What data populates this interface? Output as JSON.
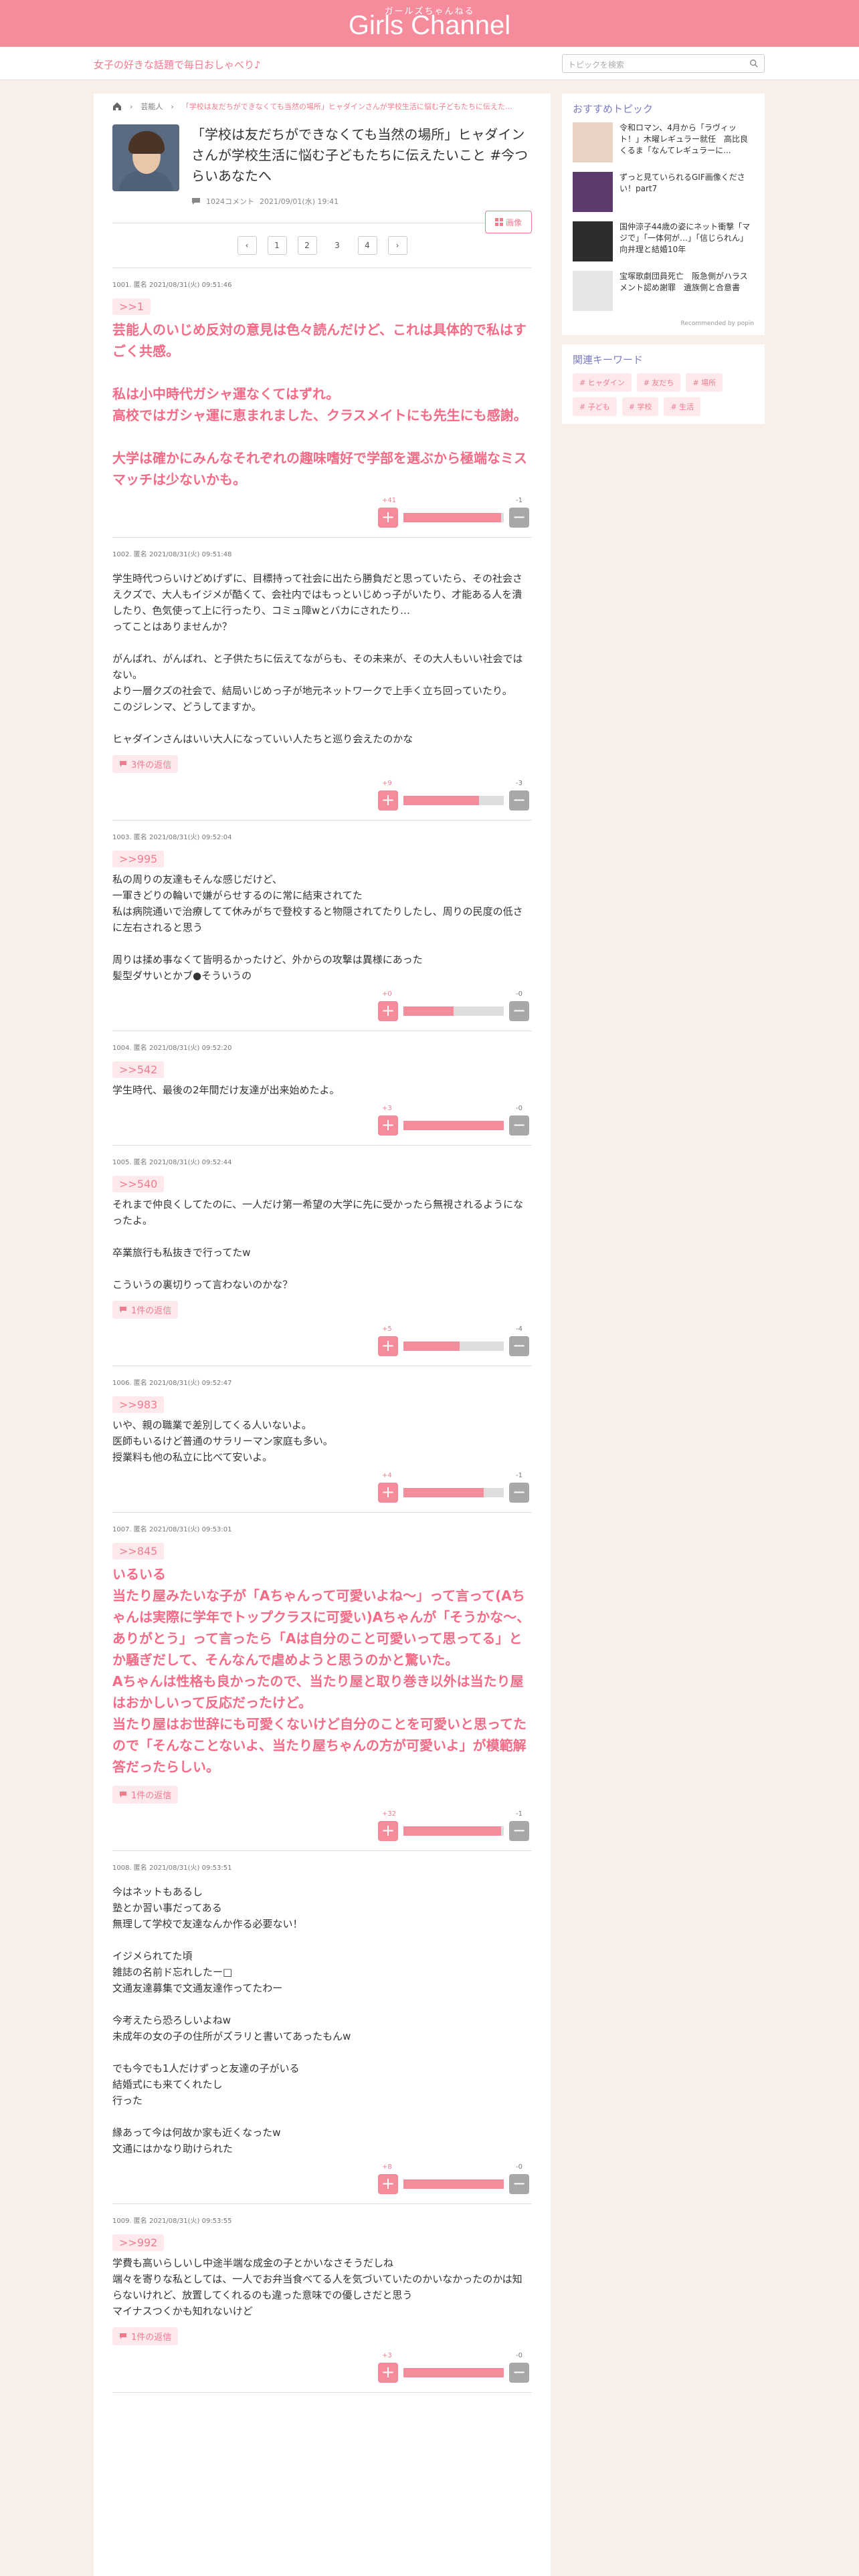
{
  "header": {
    "logo_sub": "ガールズちゃんねる",
    "logo": "Girls Channel",
    "tagline": "女子の好きな話題で毎日おしゃべり♪",
    "search_placeholder": "トピックを検索"
  },
  "breadcrumb": {
    "cat": "芸能人",
    "topic": "「学校は友だちができなくても当然の場所」ヒャダインさんが学校生活に悩む子どもたちに伝えたいこと #今つらいあなたへ"
  },
  "topic": {
    "title": "「学校は友だちができなくても当然の場所」ヒャダインさんが学校生活に悩む子どもたちに伝えたいこと #今つらいあなたへ",
    "comments": "1024コメント",
    "date": "2021/09/01(水) 19:41",
    "image_button": "画像"
  },
  "pager": {
    "prev": "‹",
    "pages": [
      "1",
      "2",
      "3",
      "4"
    ],
    "next": "›"
  },
  "comments": [
    {
      "head": "1001. 匿名 2021/08/31(火) 09:51:46",
      "anchor": ">>1",
      "text": "芸能人のいじめ反対の意見は色々読んだけど、これは具体的で私はすごく共感。\n\n私は小中時代ガシャ運なくてはずれ。\n高校ではガシャ運に恵まれました、クラスメイトにも先生にも感謝。\n\n大学は確かにみんなそれぞれの趣味嗜好で学部を選ぶから極端なミスマッチは少ないかも。",
      "plus": "+41",
      "minus": "-1",
      "ratio": 0.97
    },
    {
      "head": "1002. 匿名 2021/08/31(火) 09:51:48",
      "text": "学生時代つらいけどめげずに、目標持って社会に出たら勝負だと思っていたら、その社会さえクズで、大人もイジメが酷くて、会社内ではもっといじめっ子がいたり、才能ある人を潰したり、色気使って上に行ったり、コミュ障wとバカにされたり…\nってことはありませんか？\n\nがんばれ、がんばれ、と子供たちに伝えてながらも、その未来が、その大人もいい社会ではない。\nより一層クズの社会で、結局いじめっ子が地元ネットワークで上手く立ち回っていたり。\nこのジレンマ、どうしてますか。\n\nヒャダインさんはいい大人になっていい人たちと巡り会えたのかな",
      "reply": "3件の返信",
      "plus": "+9",
      "minus": "-3",
      "ratio": 0.75
    },
    {
      "head": "1003. 匿名 2021/08/31(火) 09:52:04",
      "anchor": ">>995",
      "text": "私の周りの友達もそんな感じだけど、\n一軍きどりの輪いで嫌がらせするのに常に結束されてた\n私は病院通いで治療してて休みがちで登校すると物隠されてたりしたし、周りの民度の低さに左右されると思う\n\n周りは揉め事なくて皆明るかったけど、外からの攻撃は異様にあった\n髪型ダサいとかブ●そういうの",
      "plus": "+0",
      "minus": "-0",
      "ratio": 0.5
    },
    {
      "head": "1004. 匿名 2021/08/31(火) 09:52:20",
      "anchor": ">>542",
      "text": "学生時代、最後の2年間だけ友達が出来始めたよ。",
      "plus": "+3",
      "minus": "-0",
      "ratio": 1
    },
    {
      "head": "1005. 匿名 2021/08/31(火) 09:52:44",
      "anchor": ">>540",
      "text": "それまで仲良くしてたのに、一人だけ第一希望の大学に先に受かったら無視されるようになったよ。\n\n卒業旅行も私抜きで行ってたw\n\nこういうの裏切りって言わないのかな？",
      "reply": "1件の返信",
      "plus": "+5",
      "minus": "-4",
      "ratio": 0.56
    },
    {
      "head": "1006. 匿名 2021/08/31(火) 09:52:47",
      "anchor": ">>983",
      "text": "いや、親の職業で差別してくる人いないよ。\n医師もいるけど普通のサラリーマン家庭も多い。\n授業料も他の私立に比べて安いよ。",
      "plus": "+4",
      "minus": "-1",
      "ratio": 0.8
    },
    {
      "head": "1007. 匿名 2021/08/31(火) 09:53:01",
      "anchor": ">>845",
      "text": "いるいる\n当たり屋みたいな子が「Aちゃんって可愛いよね〜」って言って(Aちゃんは実際に学年でトップクラスに可愛い)Aちゃんが「そうかな〜、ありがとう」って言ったら「Aは自分のこと可愛いって思ってる」とか騒ぎだして、そんなんで虐めようと思うのかと驚いた。\nAちゃんは性格も良かったので、当たり屋と取り巻き以外は当たり屋はおかしいって反応だったけど。\n当たり屋はお世辞にも可愛くないけど自分のことを可愛いと思ってたので「そんなことないよ、当たり屋ちゃんの方が可愛いよ」が模範解答だったらしい。",
      "reply": "1件の返信",
      "plus": "+32",
      "minus": "-1",
      "ratio": 0.97
    },
    {
      "head": "1008. 匿名 2021/08/31(火) 09:53:51",
      "text": "今はネットもあるし\n塾とか習い事だってある\n無理して学校で友達なんか作る必要ない！\n\nイジメられてた頃\n雑誌の名前ド忘れしたー□\n文通友達募集で文通友達作ってたわー\n\n今考えたら恐ろしいよねw\n未成年の女の子の住所がズラリと書いてあったもんw\n\nでも今でも1人だけずっと友達の子がいる\n結婚式にも来てくれたし\n行った\n\n縁あって今は何故か家も近くなったw\n文通にはかなり助けられた",
      "plus": "+8",
      "minus": "-0",
      "ratio": 1
    },
    {
      "head": "1009. 匿名 2021/08/31(火) 09:53:55",
      "anchor": ">>992",
      "text": "学費も高いらしいし中途半端な成金の子とかいなさそうだしね\n端々を寄りな私としては、一人でお弁当食べてる人を気づいていたのかいなかったのかは知らないけれど、放置してくれるのも違った意味での優しさだと思う\nマイナスつくかも知れないけど",
      "reply": "1件の返信",
      "plus": "+3",
      "minus": "-0",
      "ratio": 1
    }
  ],
  "side": {
    "rec_title": "おすすめトピック",
    "recs": [
      "令和ロマン、4月から「ラヴィット！」木曜レギュラー就任　高比良くるま「なんてレギュラーに...",
      "ずっと見ていられるGIF画像ください！part7",
      "国仲涼子44歳の姿にネット衝撃「マジで」「一体何が…」「信じられん」向井理と結婚10年",
      "宝塚歌劇団員死亡　阪急側がハラスメント認め謝罪　遺族側と合意書"
    ],
    "powered": "Recommended by",
    "powered_brand": "popin",
    "kw_title": "関連キーワード",
    "kws": [
      "# ヒャダイン",
      "# 友だち",
      "# 場所",
      "# 子ども",
      "# 学校",
      "# 生活"
    ]
  }
}
